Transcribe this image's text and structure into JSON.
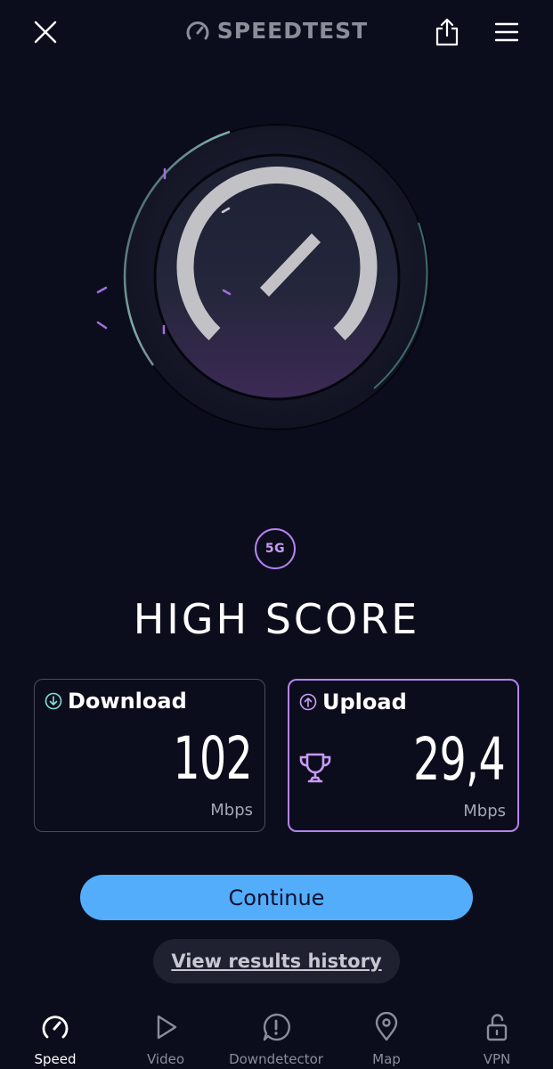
{
  "header": {
    "close_icon": "close-icon",
    "brand": "SPEEDTEST",
    "share_icon": "share-icon",
    "menu_icon": "menu-icon"
  },
  "gauge": {
    "icon": "speedometer-icon"
  },
  "network": {
    "badge": "5G"
  },
  "headline": "HIGH SCORE",
  "download": {
    "label": "Download",
    "value": "102",
    "unit": "Mbps",
    "icon": "arrow-down-circle-icon"
  },
  "upload": {
    "label": "Upload",
    "value": "29,4",
    "unit": "Mbps",
    "icon": "arrow-up-circle-icon",
    "badge_icon": "trophy-icon"
  },
  "actions": {
    "continue": "Continue",
    "history": "View results history"
  },
  "nav": [
    {
      "label": "Speed",
      "icon": "speedometer-icon",
      "active": true
    },
    {
      "label": "Video",
      "icon": "play-icon",
      "active": false
    },
    {
      "label": "Downdetector",
      "icon": "alert-icon",
      "active": false
    },
    {
      "label": "Map",
      "icon": "map-pin-icon",
      "active": false
    },
    {
      "label": "VPN",
      "icon": "lock-icon",
      "active": false
    }
  ],
  "colors": {
    "background": "#0c0d1c",
    "accent_purple": "#b682f2",
    "accent_blue": "#53adfa",
    "muted_text": "#8b8d99"
  }
}
